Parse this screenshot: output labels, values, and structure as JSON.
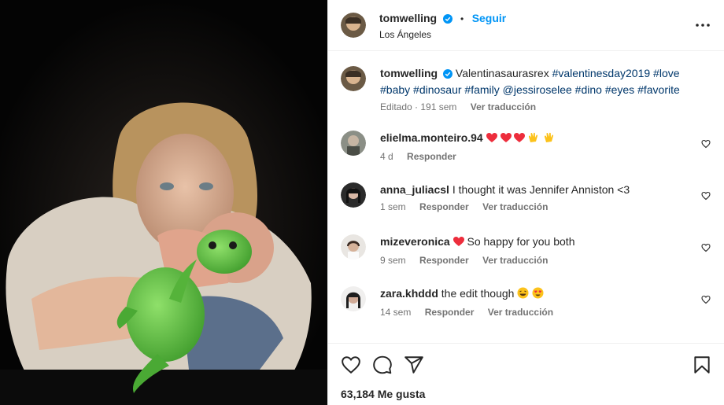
{
  "post": {
    "username": "tomwelling",
    "follow_label": "Seguir",
    "location": "Los Ángeles",
    "caption_text": "Valentinasaurasrex",
    "caption_tags": "#valentinesday2019 #love #baby #dinosaur #family @jessiroselee #dino #eyes #favorite",
    "caption_edited": "Editado · 191 sem",
    "caption_translate": "Ver traducción",
    "likes": "63,184 Me gusta"
  },
  "comments": [
    {
      "user": "elielma.monteiro.94",
      "text": "",
      "time": "4 d",
      "reply": "Responder",
      "translate": ""
    },
    {
      "user": "anna_juliacsl",
      "text": "I thought it was Jennifer Anniston <3",
      "time": "1 sem",
      "reply": "Responder",
      "translate": "Ver traducción"
    },
    {
      "user": "mizeveronica",
      "text": "So happy for you both",
      "time": "9 sem",
      "reply": "Responder",
      "translate": "Ver traducción"
    },
    {
      "user": "zara.khddd",
      "text": "the edit though",
      "time": "14 sem",
      "reply": "Responder",
      "translate": "Ver traducción"
    }
  ],
  "colors": {
    "accent": "#0095f6",
    "heart_red": "#ed4956",
    "verified": "#0095f6",
    "tag": "#00376b"
  },
  "icons": [
    "more-options-icon",
    "heart-icon",
    "comment-icon",
    "share-icon",
    "bookmark-icon",
    "verified-badge-icon"
  ]
}
